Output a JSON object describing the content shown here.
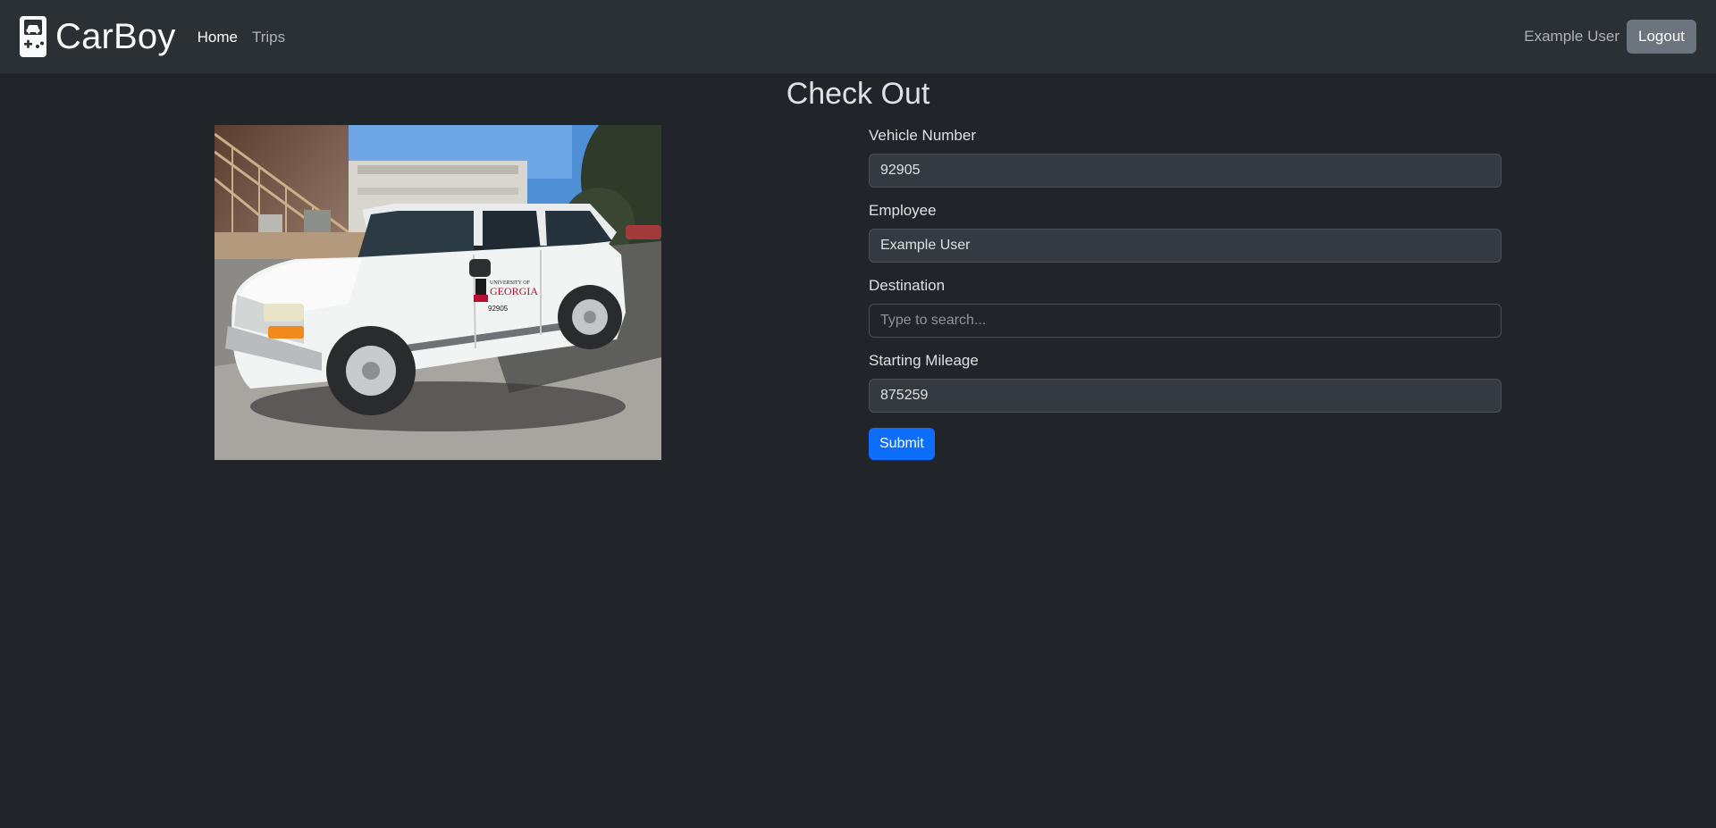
{
  "navbar": {
    "brand": "CarBoy",
    "brand_icon": "gameboy-car-icon",
    "links": [
      {
        "label": "Home",
        "active": true
      },
      {
        "label": "Trips",
        "active": false
      }
    ],
    "user_name": "Example User",
    "logout_label": "Logout"
  },
  "page": {
    "title": "Check Out",
    "photo_description": "vehicle-photo"
  },
  "form": {
    "vehicle_number": {
      "label": "Vehicle Number",
      "value": "92905"
    },
    "employee": {
      "label": "Employee",
      "value": "Example User"
    },
    "destination": {
      "label": "Destination",
      "value": "",
      "placeholder": "Type to search..."
    },
    "starting_mileage": {
      "label": "Starting Mileage",
      "value": "875259"
    },
    "submit_label": "Submit"
  },
  "photo_text": {
    "decal_line1": "UNIVERSITY OF",
    "decal_line2": "GEORGIA",
    "decal_number": "92905"
  },
  "colors": {
    "background": "#212529",
    "navbar": "#2b3035",
    "primary": "#0d6efd",
    "secondary": "#6c757d"
  }
}
